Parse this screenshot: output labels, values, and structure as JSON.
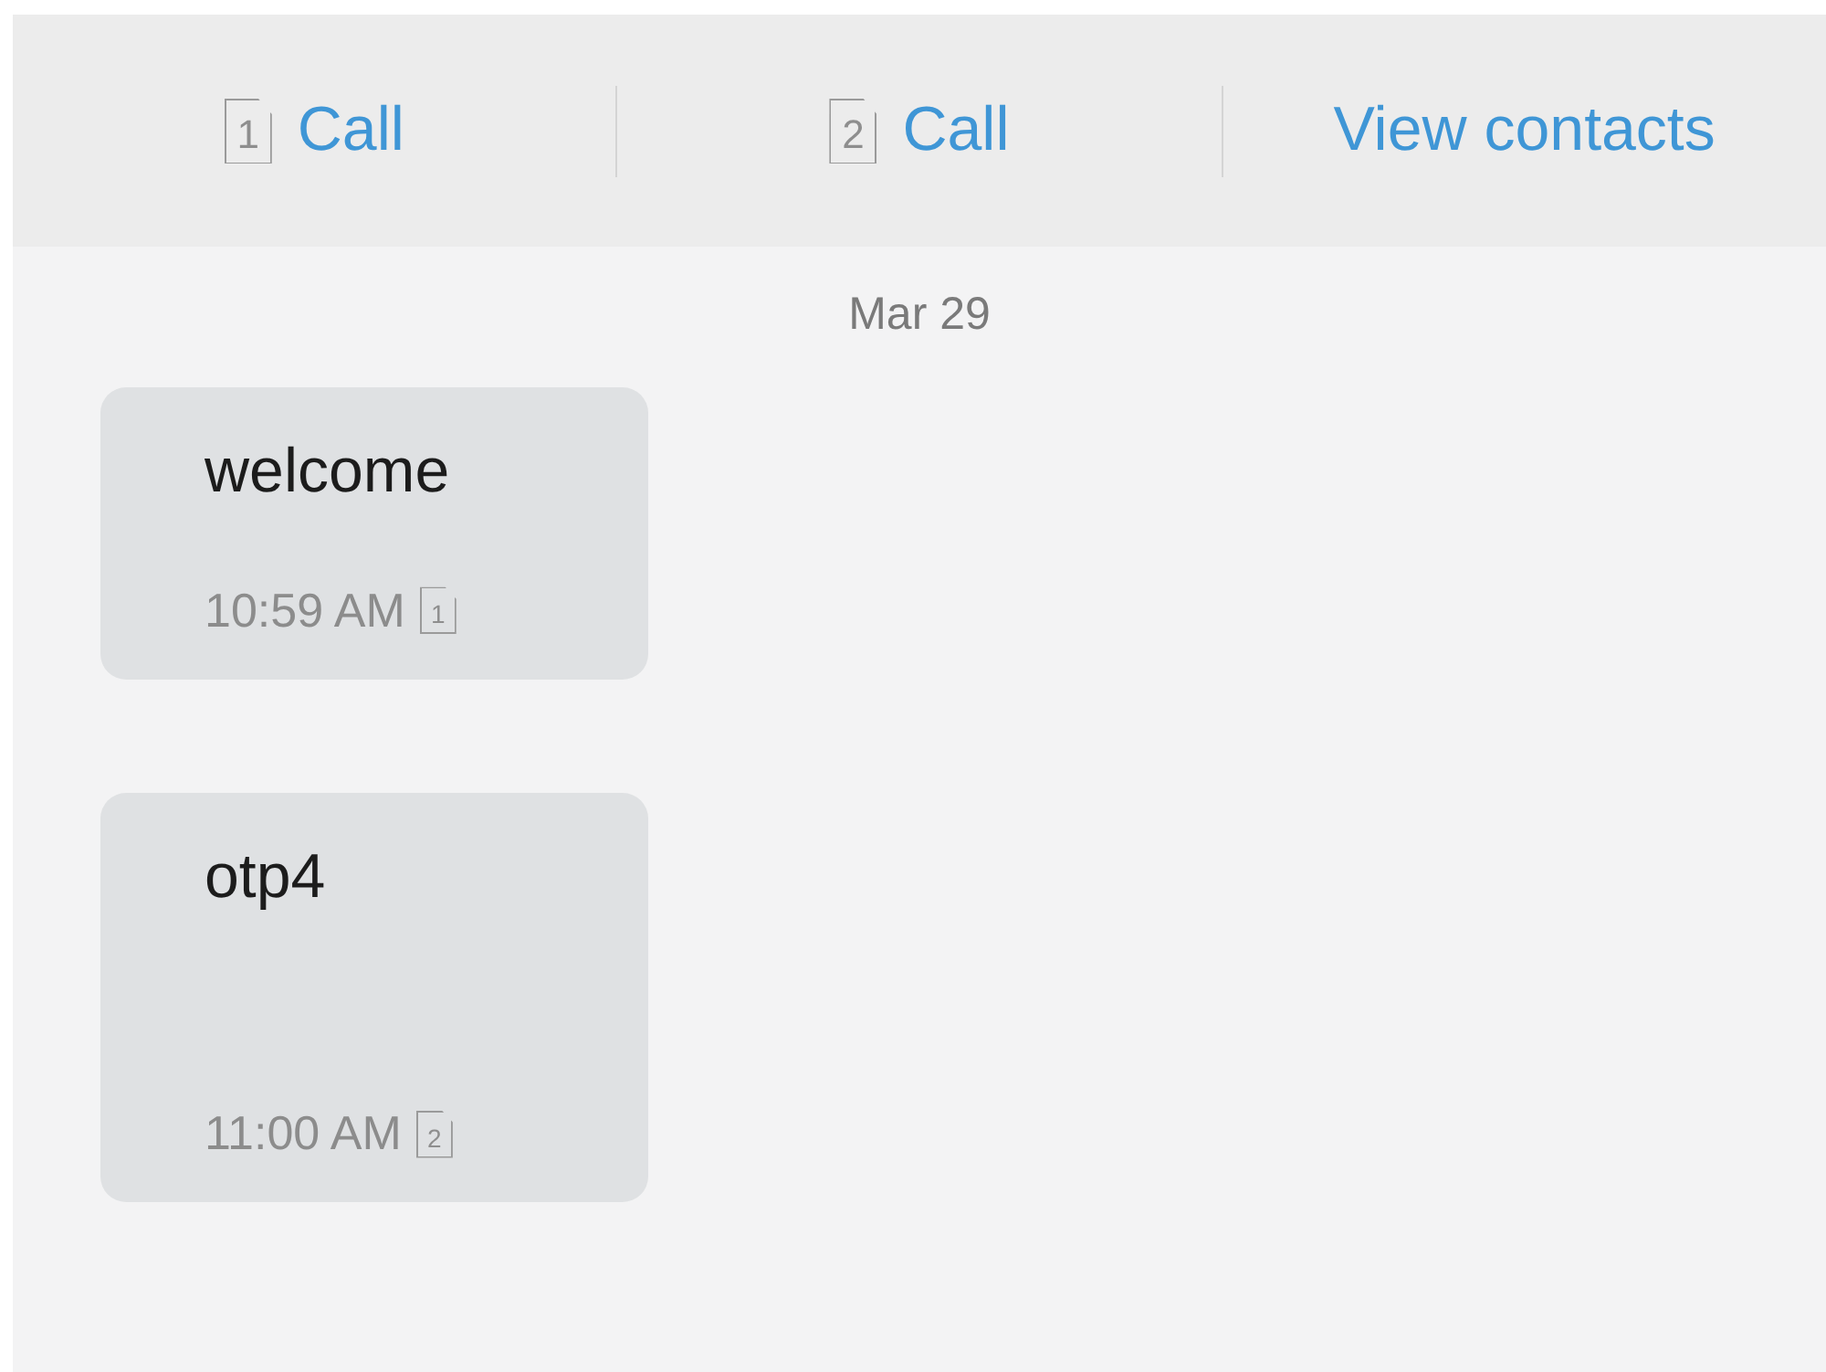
{
  "actions": [
    {
      "kind": "sim_call",
      "sim": "1",
      "label": "Call"
    },
    {
      "kind": "sim_call",
      "sim": "2",
      "label": "Call"
    },
    {
      "kind": "link",
      "label": "View contacts"
    }
  ],
  "date": "Mar 29",
  "messages": [
    {
      "text": "welcome",
      "time": "10:59 AM",
      "sim": "1",
      "tall": false
    },
    {
      "text": "otp4",
      "time": "11:00 AM",
      "sim": "2",
      "tall": true
    }
  ]
}
